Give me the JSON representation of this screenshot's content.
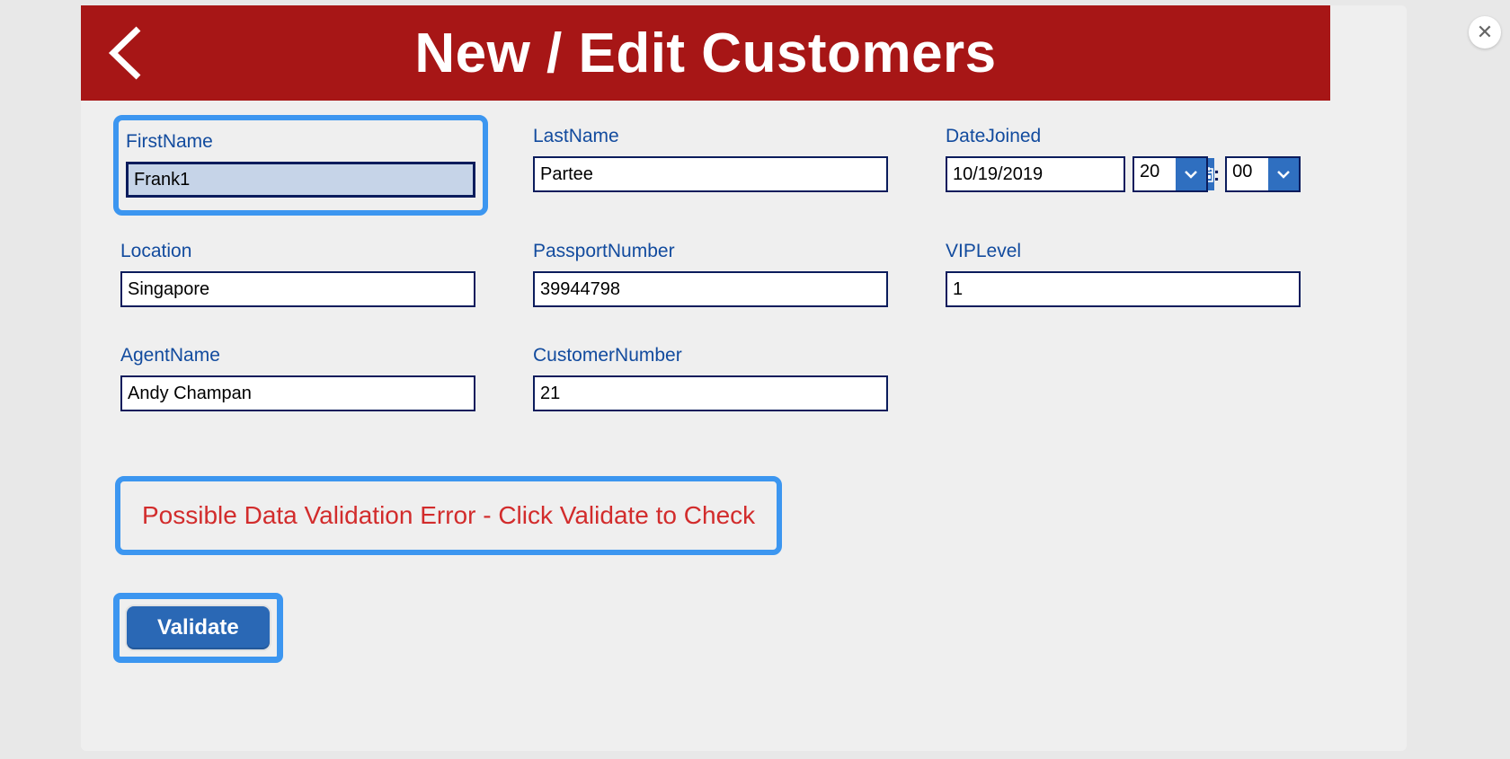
{
  "header": {
    "title": "New / Edit Customers"
  },
  "fields": {
    "firstName": {
      "label": "FirstName",
      "value": "Frank1"
    },
    "lastName": {
      "label": "LastName",
      "value": "Partee"
    },
    "dateJoined": {
      "label": "DateJoined",
      "date": "10/19/2019",
      "hour": "20",
      "minute": "00",
      "separator": ":"
    },
    "location": {
      "label": "Location",
      "value": "Singapore"
    },
    "passportNumber": {
      "label": "PassportNumber",
      "value": "39944798"
    },
    "vipLevel": {
      "label": "VIPLevel",
      "value": "1"
    },
    "agentName": {
      "label": "AgentName",
      "value": "Andy Champan"
    },
    "customerNumber": {
      "label": "CustomerNumber",
      "value": "21"
    }
  },
  "validation": {
    "message": "Possible Data Validation Error - Click Validate to Check"
  },
  "buttons": {
    "validate": "Validate"
  }
}
